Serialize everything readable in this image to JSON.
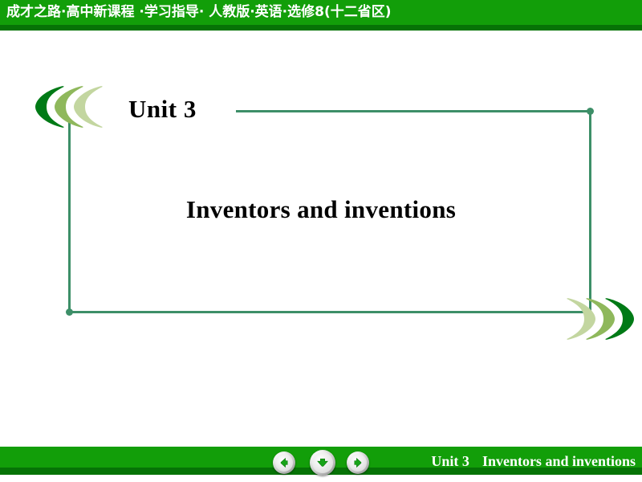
{
  "header": {
    "title": "成才之路·高中新课程 ·学习指导· 人教版·英语·选修8(十二省区)",
    "bg_color": "#129e09",
    "shadow_color": "#067306",
    "text_color": "#ffffff"
  },
  "body": {
    "unit_label": "Unit 3",
    "main_title": "Inventors and inventions",
    "frame_color": "#3d8f68",
    "text_color": "#000000"
  },
  "decorations": {
    "left_chevrons": {
      "name": "left-pointing-chevrons",
      "colors": [
        "#007a16",
        "#8fb85c",
        "#c3d6a0"
      ]
    },
    "right_chevrons": {
      "name": "right-pointing-chevrons",
      "colors": [
        "#c3d6a0",
        "#8fb85c",
        "#007a16"
      ]
    }
  },
  "footer": {
    "unit_label": "Unit 3",
    "title": "Inventors and inventions",
    "bg_color": "#129e09",
    "shadow_color": "#067306",
    "text_color": "#ffffff",
    "nav": {
      "prev": "previous-slide",
      "down": "next-animation",
      "next": "next-slide",
      "arrow_color": "#17a318"
    }
  }
}
